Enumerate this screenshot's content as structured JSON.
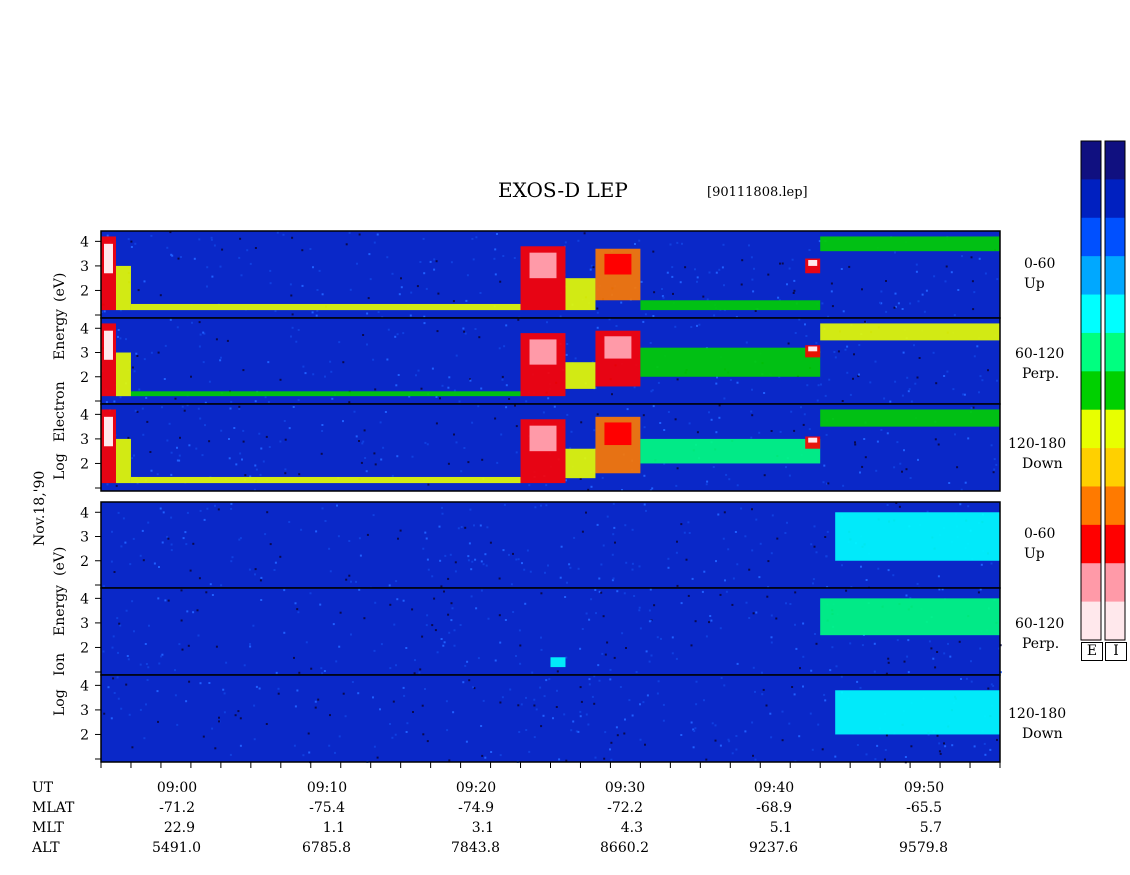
{
  "header": {
    "title": "EXOS-D LEP",
    "filename": "[90111808.lep]"
  },
  "date_label": "Nov.18,'90",
  "colors": {
    "electron_scale": [
      "#ffe8ec",
      "#ff9aa8",
      "#ff0000",
      "#ff7a00",
      "#ffd000",
      "#e8ff00",
      "#00d000",
      "#00ff80",
      "#00ffff",
      "#00a8ff",
      "#0050ff",
      "#0020c0",
      "#101080"
    ],
    "ion_scale": [
      "#ffe8ec",
      "#ff9aa8",
      "#ff0000",
      "#ff7a00",
      "#ffd000",
      "#e8ff00",
      "#00d000",
      "#00ff80",
      "#00ffff",
      "#00a8ff",
      "#0050ff",
      "#0020c0",
      "#101080"
    ],
    "background_blue": "#0a28c8"
  },
  "colorbars": {
    "electron_label": "E",
    "ion_label": "I"
  },
  "electron_group": {
    "ylabel_line1": "Log",
    "ylabel_line2": "Electron",
    "ylabel_line3": "Energy",
    "ylabel_line4": "(eV)",
    "panels": [
      {
        "pitch": "0-60",
        "dir": "Up"
      },
      {
        "pitch": "60-120",
        "dir": "Perp."
      },
      {
        "pitch": "120-180",
        "dir": "Down"
      }
    ]
  },
  "ion_group": {
    "ylabel_line1": "Log",
    "ylabel_line2": "Ion",
    "ylabel_line3": "Energy",
    "ylabel_line4": "(eV)",
    "panels": [
      {
        "pitch": "0-60",
        "dir": "Up"
      },
      {
        "pitch": "60-120",
        "dir": "Perp."
      },
      {
        "pitch": "120-180",
        "dir": "Down"
      }
    ]
  },
  "axis_rows": {
    "labels": [
      "UT",
      "MLAT",
      "MLT",
      "ALT"
    ],
    "UT": [
      "09:00",
      "09:10",
      "09:20",
      "09:30",
      "09:40",
      "09:50"
    ],
    "MLAT": [
      "-71.2",
      "-75.4",
      "-74.9",
      "-72.2",
      "-68.9",
      "-65.5"
    ],
    "MLT": [
      "22.9",
      "1.1",
      "3.1",
      "4.3",
      "5.1",
      "5.7"
    ],
    "ALT": [
      "5491.0",
      "6785.8",
      "7843.8",
      "8660.2",
      "9237.6",
      "9579.8"
    ]
  },
  "chart_data": {
    "type": "heatmap",
    "title": "EXOS-D LEP",
    "time_range": [
      "08:55",
      "09:55"
    ],
    "y_ticks": [
      "4",
      "3",
      "2",
      "1"
    ],
    "ylim": [
      1,
      4.3
    ],
    "electron_panels": [
      {
        "name": "0-60 Up",
        "background": 0.15,
        "features": [
          {
            "t0": "08:55",
            "t1": "08:56",
            "e0": 1.2,
            "e1": 4.2,
            "level": 0.85
          },
          {
            "t0": "08:56",
            "t1": "08:57",
            "e0": 1.2,
            "e1": 3.0,
            "level": 0.55
          },
          {
            "t0": "08:57",
            "t1": "09:23",
            "e0": 1.2,
            "e1": 1.45,
            "level": 0.55
          },
          {
            "t0": "09:23",
            "t1": "09:26",
            "e0": 1.2,
            "e1": 3.8,
            "level": 0.8
          },
          {
            "t0": "09:26",
            "t1": "09:28",
            "e0": 1.2,
            "e1": 2.5,
            "level": 0.55
          },
          {
            "t0": "09:28",
            "t1": "09:31",
            "e0": 1.6,
            "e1": 3.7,
            "level": 0.75
          },
          {
            "t0": "09:31",
            "t1": "09:43",
            "e0": 1.2,
            "e1": 1.6,
            "level": 0.5
          },
          {
            "t0": "09:42",
            "t1": "09:43",
            "e0": 2.7,
            "e1": 3.3,
            "level": 0.85
          },
          {
            "t0": "09:43",
            "t1": "09:55",
            "e0": 3.6,
            "e1": 4.2,
            "level": 0.5
          }
        ]
      },
      {
        "name": "60-120 Perp.",
        "background": 0.08,
        "features": [
          {
            "t0": "08:55",
            "t1": "08:56",
            "e0": 1.2,
            "e1": 4.2,
            "level": 0.85
          },
          {
            "t0": "08:56",
            "t1": "08:57",
            "e0": 1.2,
            "e1": 3.0,
            "level": 0.55
          },
          {
            "t0": "08:57",
            "t1": "09:23",
            "e0": 1.2,
            "e1": 1.4,
            "level": 0.5
          },
          {
            "t0": "09:23",
            "t1": "09:26",
            "e0": 1.2,
            "e1": 3.8,
            "level": 0.8
          },
          {
            "t0": "09:26",
            "t1": "09:28",
            "e0": 1.5,
            "e1": 2.6,
            "level": 0.55
          },
          {
            "t0": "09:28",
            "t1": "09:31",
            "e0": 1.6,
            "e1": 3.9,
            "level": 0.8
          },
          {
            "t0": "09:31",
            "t1": "09:43",
            "e0": 2.0,
            "e1": 3.2,
            "level": 0.5
          },
          {
            "t0": "09:42",
            "t1": "09:43",
            "e0": 2.8,
            "e1": 3.3,
            "level": 0.85
          },
          {
            "t0": "09:43",
            "t1": "09:55",
            "e0": 3.5,
            "e1": 4.2,
            "level": 0.55
          }
        ]
      },
      {
        "name": "120-180 Down",
        "background": 0.12,
        "features": [
          {
            "t0": "08:55",
            "t1": "08:56",
            "e0": 1.2,
            "e1": 4.2,
            "level": 0.85
          },
          {
            "t0": "08:56",
            "t1": "08:57",
            "e0": 1.2,
            "e1": 3.0,
            "level": 0.55
          },
          {
            "t0": "08:57",
            "t1": "09:23",
            "e0": 1.2,
            "e1": 1.45,
            "level": 0.55
          },
          {
            "t0": "09:23",
            "t1": "09:26",
            "e0": 1.2,
            "e1": 3.8,
            "level": 0.8
          },
          {
            "t0": "09:26",
            "t1": "09:28",
            "e0": 1.4,
            "e1": 2.6,
            "level": 0.55
          },
          {
            "t0": "09:28",
            "t1": "09:31",
            "e0": 1.6,
            "e1": 3.9,
            "level": 0.75
          },
          {
            "t0": "09:31",
            "t1": "09:43",
            "e0": 2.0,
            "e1": 3.0,
            "level": 0.45
          },
          {
            "t0": "09:42",
            "t1": "09:43",
            "e0": 2.6,
            "e1": 3.1,
            "level": 0.85
          },
          {
            "t0": "09:43",
            "t1": "09:55",
            "e0": 3.5,
            "e1": 4.2,
            "level": 0.5
          }
        ]
      }
    ],
    "ion_panels": [
      {
        "name": "0-60 Up",
        "background": 0.2,
        "features": [
          {
            "t0": "09:44",
            "t1": "09:55",
            "e0": 2.0,
            "e1": 4.0,
            "level": 0.35
          }
        ]
      },
      {
        "name": "60-120 Perp.",
        "background": 0.1,
        "features": [
          {
            "t0": "09:25",
            "t1": "09:26",
            "e0": 1.2,
            "e1": 1.6,
            "level": 0.35
          },
          {
            "t0": "09:43",
            "t1": "09:55",
            "e0": 2.5,
            "e1": 4.0,
            "level": 0.4
          }
        ]
      },
      {
        "name": "120-180 Down",
        "background": 0.18,
        "features": [
          {
            "t0": "09:44",
            "t1": "09:55",
            "e0": 2.0,
            "e1": 3.8,
            "level": 0.35
          }
        ]
      }
    ]
  }
}
